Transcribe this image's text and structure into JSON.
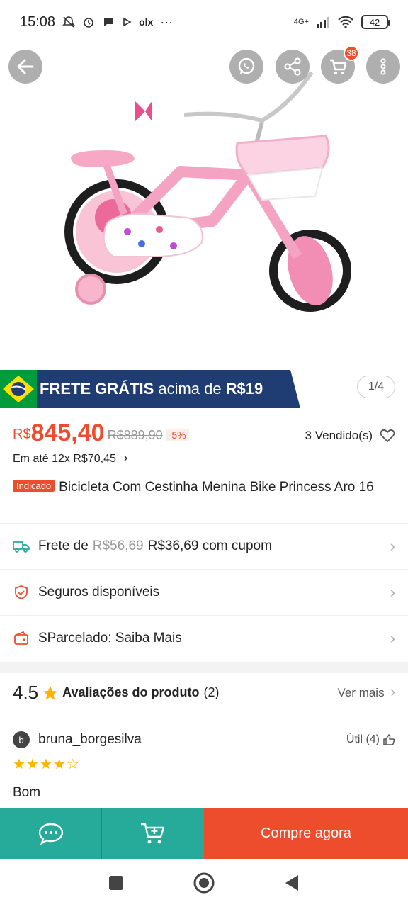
{
  "status_bar": {
    "time": "15:08",
    "app_icons": [
      "mute-bell-icon",
      "alarm-icon",
      "chat-bubble-icon",
      "play-icon"
    ],
    "olx_label": "olx",
    "more": "···",
    "network": "4G+",
    "battery": "42"
  },
  "hero": {
    "cart_count": "38",
    "image_desc_icon": "pink-bicycle-image"
  },
  "promo": {
    "strong1": "FRETE GRÁTIS",
    "light": "acima de",
    "strong2": "R$19",
    "colors": {
      "banner": "#1f3d73",
      "flag_green": "#009c3b",
      "flag_yellow": "#ffdf00"
    }
  },
  "page_indicator": "1/4",
  "price": {
    "currency": "R$",
    "value": "845,40",
    "old": "R$889,90",
    "discount": "-5%",
    "sold": "3 Vendido(s)",
    "installment": "Em até 12x R$70,45",
    "installment_chevron": "›"
  },
  "product": {
    "tag": "Indicado",
    "title": "Bicicleta Com Cestinha Menina Bike Princess Aro 16"
  },
  "rows": [
    {
      "prefix": "Frete de",
      "strike": "R$56,69",
      "suffix": "R$36,69 com cupom",
      "chevron": "›"
    },
    {
      "label": "Seguros disponíveis",
      "chevron": "›"
    },
    {
      "label": "SParcelado: Saiba Mais",
      "chevron": "›"
    }
  ],
  "reviews": {
    "score": "4.5",
    "label": "Avaliações do produto",
    "count": "(2)",
    "see_more": "Ver mais",
    "see_more_chevron": "›",
    "reviewer": {
      "initial": "b",
      "name": "bruna_borgesilva",
      "useful": "Útil (4)"
    },
    "stars": "★★★★☆",
    "text": "Bom"
  },
  "actions": {
    "buy": "Compre agora"
  },
  "colors": {
    "accent": "#ee4d2d",
    "teal": "#26aa99"
  }
}
